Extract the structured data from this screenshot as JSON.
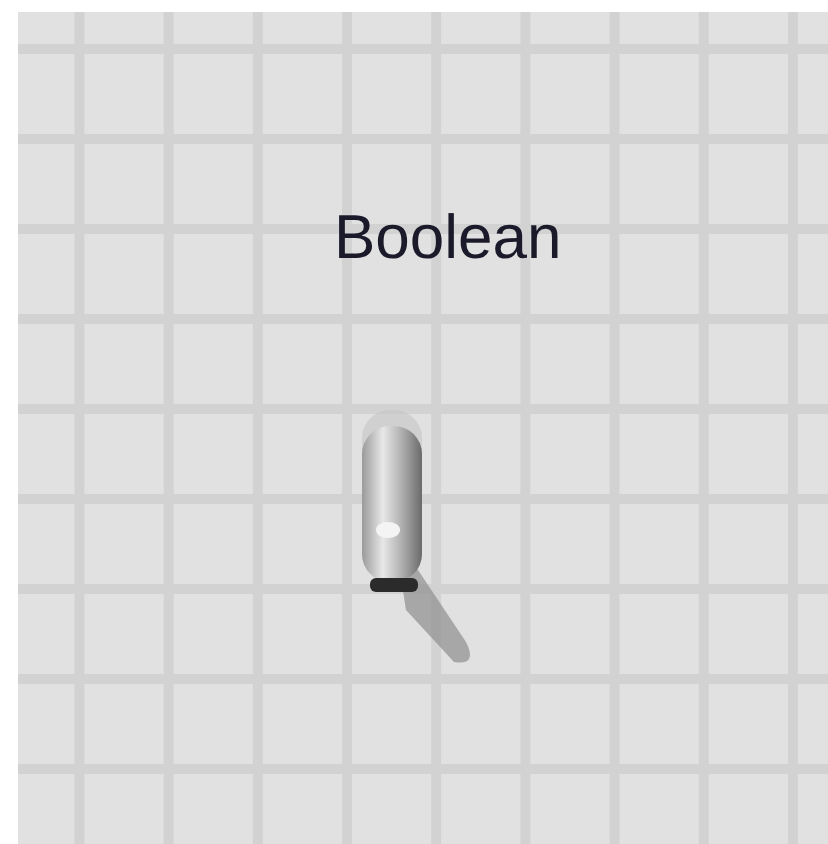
{
  "control": {
    "label": "Boolean",
    "on": false
  }
}
